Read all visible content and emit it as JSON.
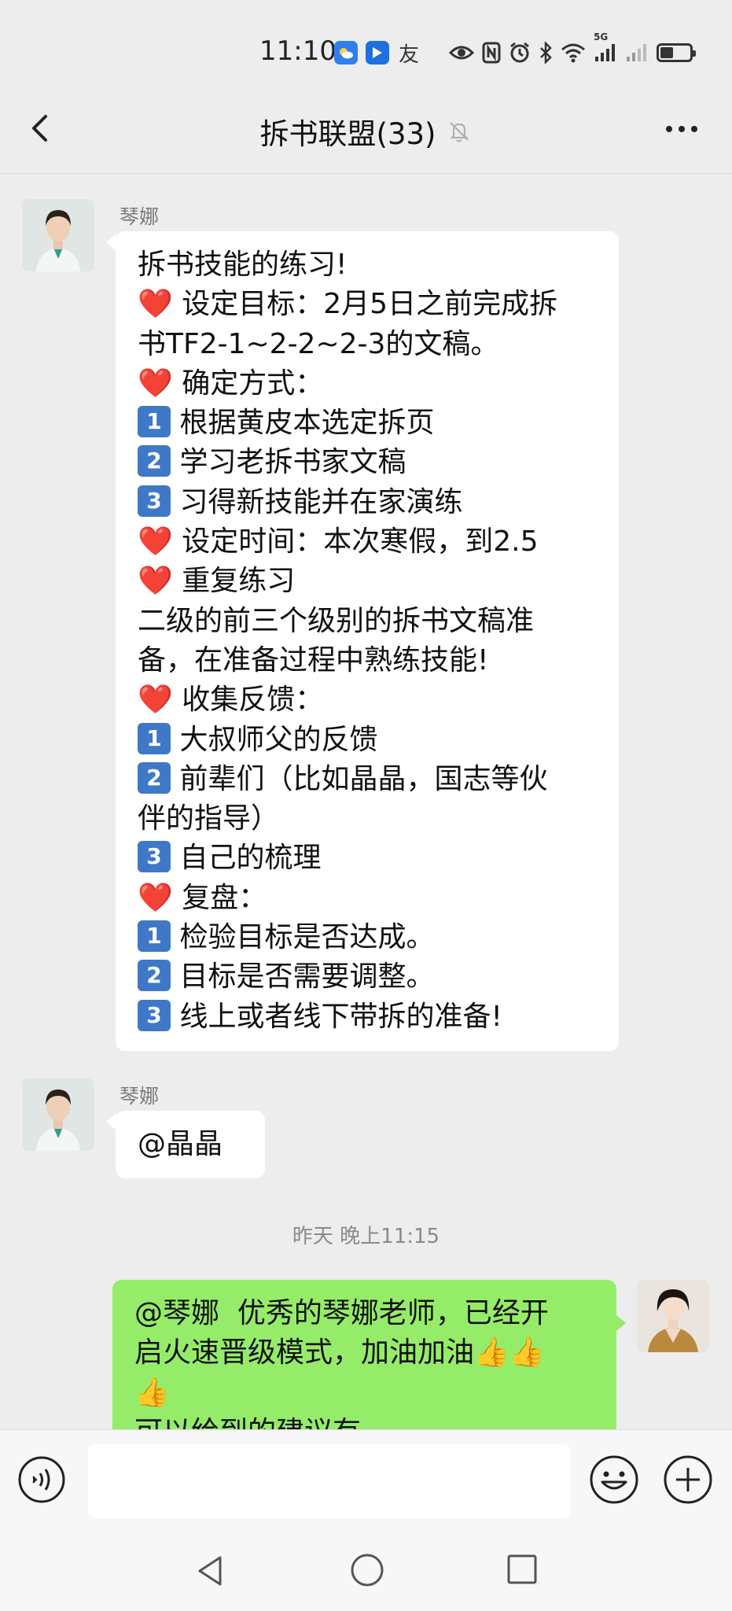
{
  "status_bar": {
    "time": "11:10",
    "network_label": "5G",
    "battery_percent": 45,
    "icons": [
      "weather-app-icon",
      "tencent-app-icon",
      "friend-app-icon",
      "eye-icon",
      "nfc-icon",
      "alarm-icon",
      "bluetooth-icon",
      "wifi-icon",
      "signal-icon",
      "signal-2-icon",
      "battery-icon"
    ]
  },
  "header": {
    "title": "拆书联盟(33)",
    "muted": true,
    "icons": [
      "back-arrow-icon",
      "mute-bell-icon",
      "more-dots-icon"
    ]
  },
  "messages": [
    {
      "sender": "琴娜",
      "side": "left",
      "lines": [
        {
          "icon": "",
          "text": "拆书技能的练习!"
        },
        {
          "icon": "❤️",
          "text": " 设定目标：2月5日之前完成拆"
        },
        {
          "icon": "",
          "text": "书TF2-1~2-2~2-3的文稿。"
        },
        {
          "icon": "❤️",
          "text": " 确定方式："
        },
        {
          "icon": "1",
          "text": " 根据黄皮本选定拆页"
        },
        {
          "icon": "2",
          "text": " 学习老拆书家文稿"
        },
        {
          "icon": "3",
          "text": " 习得新技能并在家演练"
        },
        {
          "icon": "❤️",
          "text": " 设定时间：本次寒假，到2.5"
        },
        {
          "icon": "❤️",
          "text": " 重复练习"
        },
        {
          "icon": "",
          "text": "二级的前三个级别的拆书文稿准"
        },
        {
          "icon": "",
          "text": "备，在准备过程中熟练技能!"
        },
        {
          "icon": "❤️",
          "text": " 收集反馈："
        },
        {
          "icon": "1",
          "text": " 大叔师父的反馈"
        },
        {
          "icon": "2",
          "text": " 前辈们（比如晶晶，国志等伙"
        },
        {
          "icon": "",
          "text": "伴的指导）"
        },
        {
          "icon": "3",
          "text": " 自己的梳理"
        },
        {
          "icon": "❤️",
          "text": " 复盘："
        },
        {
          "icon": "1",
          "text": " 检验目标是否达成。"
        },
        {
          "icon": "2",
          "text": " 目标是否需要调整。"
        },
        {
          "icon": "3",
          "text": " 线上或者线下带拆的准备!"
        }
      ]
    },
    {
      "sender": "琴娜",
      "side": "left",
      "lines": [
        {
          "icon": "",
          "text": "@晶晶"
        }
      ]
    },
    {
      "timestamp": "昨天 晚上11:15"
    },
    {
      "sender": "",
      "side": "right",
      "lines": [
        {
          "icon": "",
          "text": "@琴娜  优秀的琴娜老师，已经开"
        },
        {
          "icon": "",
          "text": "启火速晋级模式，加油加油👍👍"
        },
        {
          "icon": "",
          "text": "👍"
        },
        {
          "icon": "",
          "text": "可以给到的建议有"
        }
      ]
    }
  ],
  "input_bar": {
    "placeholder": "",
    "icons": [
      "voice-icon",
      "emoji-icon",
      "plus-icon"
    ]
  },
  "nav_bar": {
    "icons": [
      "nav-back-icon",
      "nav-home-icon",
      "nav-recent-icon"
    ]
  },
  "colors": {
    "background": "#ededed",
    "bubble_left": "#ffffff",
    "bubble_right": "#95ec69",
    "heart": "#e02424",
    "keycap": "#3f78c6"
  }
}
